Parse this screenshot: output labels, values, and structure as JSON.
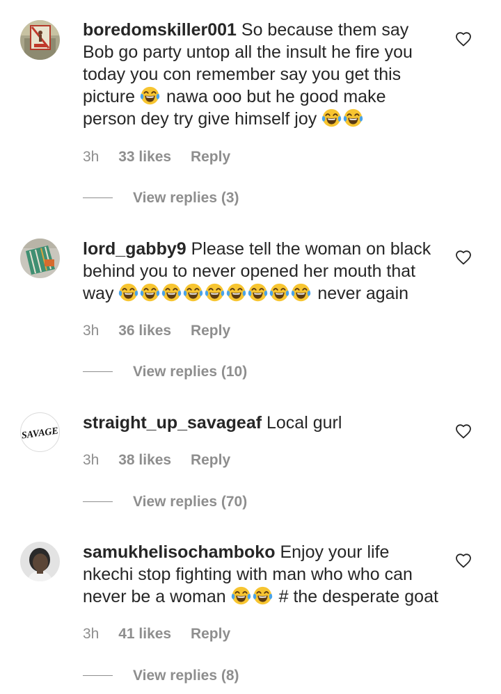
{
  "colors": {
    "text": "#262626",
    "secondary": "#8e8e8e",
    "background": "#ffffff"
  },
  "comments": [
    {
      "username": "boredomskiller001",
      "text_1": "So because them say Bob go party untop all the insult he fire you today you con remember say you get this picture",
      "emoji_1": "😂",
      "text_2": "nawa ooo but he good make person dey try give himself joy",
      "emoji_2": "😂😂",
      "time": "3h",
      "likes": "33 likes",
      "reply": "Reply",
      "view_replies": "View replies (3)",
      "avatar_icon": "avatar-sign-icon"
    },
    {
      "username": "lord_gabby9",
      "text_1": "Please tell the woman on black behind you to never opened her mouth that way",
      "emoji_1": "😂😂😂😂😂😂😂😂😂",
      "text_2": "never again",
      "time": "3h",
      "likes": "36 likes",
      "reply": "Reply",
      "view_replies": "View replies (10)",
      "avatar_icon": "avatar-fabric-icon"
    },
    {
      "username": "straight_up_savageaf",
      "text_1": "Local gurl",
      "avatar_text": "SAVAGE",
      "time": "3h",
      "likes": "38 likes",
      "reply": "Reply",
      "view_replies": "View replies (70)"
    },
    {
      "username": "samukhelisochamboko",
      "text_1": "Enjoy your life nkechi stop fighting with man who who can never be a woman",
      "emoji_1": "😂😂",
      "text_2": "# the desperate goat",
      "time": "3h",
      "likes": "41 likes",
      "reply": "Reply",
      "view_replies": "View replies (8)",
      "avatar_icon": "avatar-person-icon"
    }
  ]
}
